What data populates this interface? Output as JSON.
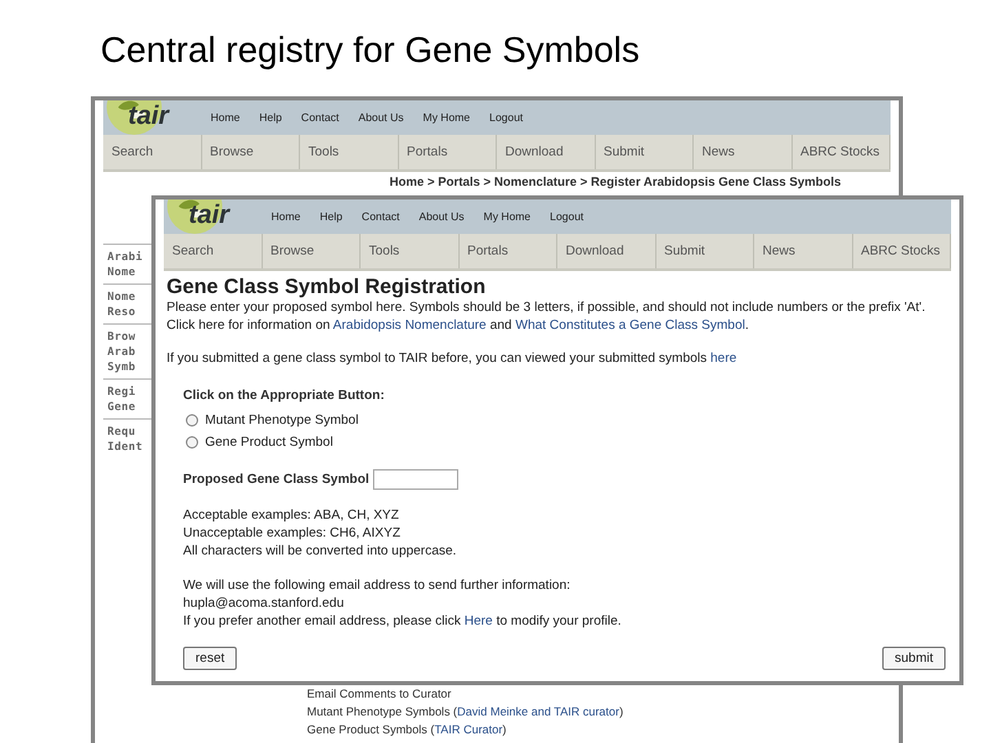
{
  "slide_title": "Central registry for Gene Symbols",
  "back_window": {
    "logo": "tair",
    "top_links": [
      "Home",
      "Help",
      "Contact",
      "About Us",
      "My Home",
      "Logout"
    ],
    "tabs": [
      "Search",
      "Browse",
      "Tools",
      "Portals",
      "Download",
      "Submit",
      "News",
      "ABRC Stocks"
    ],
    "breadcrumb": "Home > Portals > Nomenclature > Register Arabidopsis Gene Class Symbols",
    "sidebar": [
      {
        "lines": [
          "Arabi",
          "Nome"
        ]
      },
      {
        "lines": [
          "Nome",
          "Reso"
        ]
      },
      {
        "lines": [
          "Brow",
          "Arab",
          "Symb"
        ]
      },
      {
        "lines": [
          "Regi",
          "Gene"
        ]
      },
      {
        "lines": [
          "Requ",
          "Ident"
        ]
      }
    ],
    "footer": [
      [
        {
          "kind": "text",
          "text": "Email Comments to Curator"
        }
      ],
      [
        {
          "kind": "text",
          "text": "Mutant Phenotype Symbols ("
        },
        {
          "kind": "link",
          "text": "David Meinke and TAIR curator"
        },
        {
          "kind": "text",
          "text": ")"
        }
      ],
      [
        {
          "kind": "text",
          "text": "Gene Product Symbols ("
        },
        {
          "kind": "link",
          "text": "TAIR Curator"
        },
        {
          "kind": "text",
          "text": ")"
        }
      ]
    ]
  },
  "front_window": {
    "logo": "tair",
    "top_links": [
      "Home",
      "Help",
      "Contact",
      "About Us",
      "My Home",
      "Logout"
    ],
    "tabs": [
      "Search",
      "Browse",
      "Tools",
      "Portals",
      "Download",
      "Submit",
      "News",
      "ABRC Stocks"
    ],
    "heading": "Gene Class Symbol Registration",
    "intro": [
      [
        {
          "kind": "text",
          "text": "Please enter your proposed symbol here. Symbols should be 3 letters, if possible, and should not include numbers or the prefix 'At'. Click here for information on "
        },
        {
          "kind": "link",
          "text": "Arabidopsis Nomenclature"
        },
        {
          "kind": "text",
          "text": " and "
        },
        {
          "kind": "link",
          "text": "What Constitutes a Gene Class Symbol"
        },
        {
          "kind": "text",
          "text": "."
        }
      ],
      [
        {
          "kind": "text",
          "text": "If you submitted a gene class symbol to TAIR before, you can viewed your submitted symbols "
        },
        {
          "kind": "link",
          "text": "here"
        }
      ]
    ],
    "choice_label": "Click on the Appropriate Button:",
    "options": [
      {
        "label": "Mutant Phenotype Symbol",
        "selected": false
      },
      {
        "label": "Gene Product Symbol",
        "selected": false
      }
    ],
    "field_label": "Proposed Gene Class Symbol",
    "examples": [
      "Acceptable examples: ABA, CH, XYZ",
      "Unacceptable examples: CH6, AIXYZ",
      "All characters will be converted into uppercase."
    ],
    "email_lines": [
      [
        {
          "kind": "text",
          "text": "We will use the following email address to send further information:"
        }
      ],
      [
        {
          "kind": "text",
          "text": "hupla@acoma.stanford.edu"
        }
      ],
      [
        {
          "kind": "text",
          "text": "If you prefer another email address, please click "
        },
        {
          "kind": "link",
          "text": "Here"
        },
        {
          "kind": "text",
          "text": " to modify your profile."
        }
      ]
    ],
    "buttons": [
      "reset",
      "submit"
    ]
  }
}
